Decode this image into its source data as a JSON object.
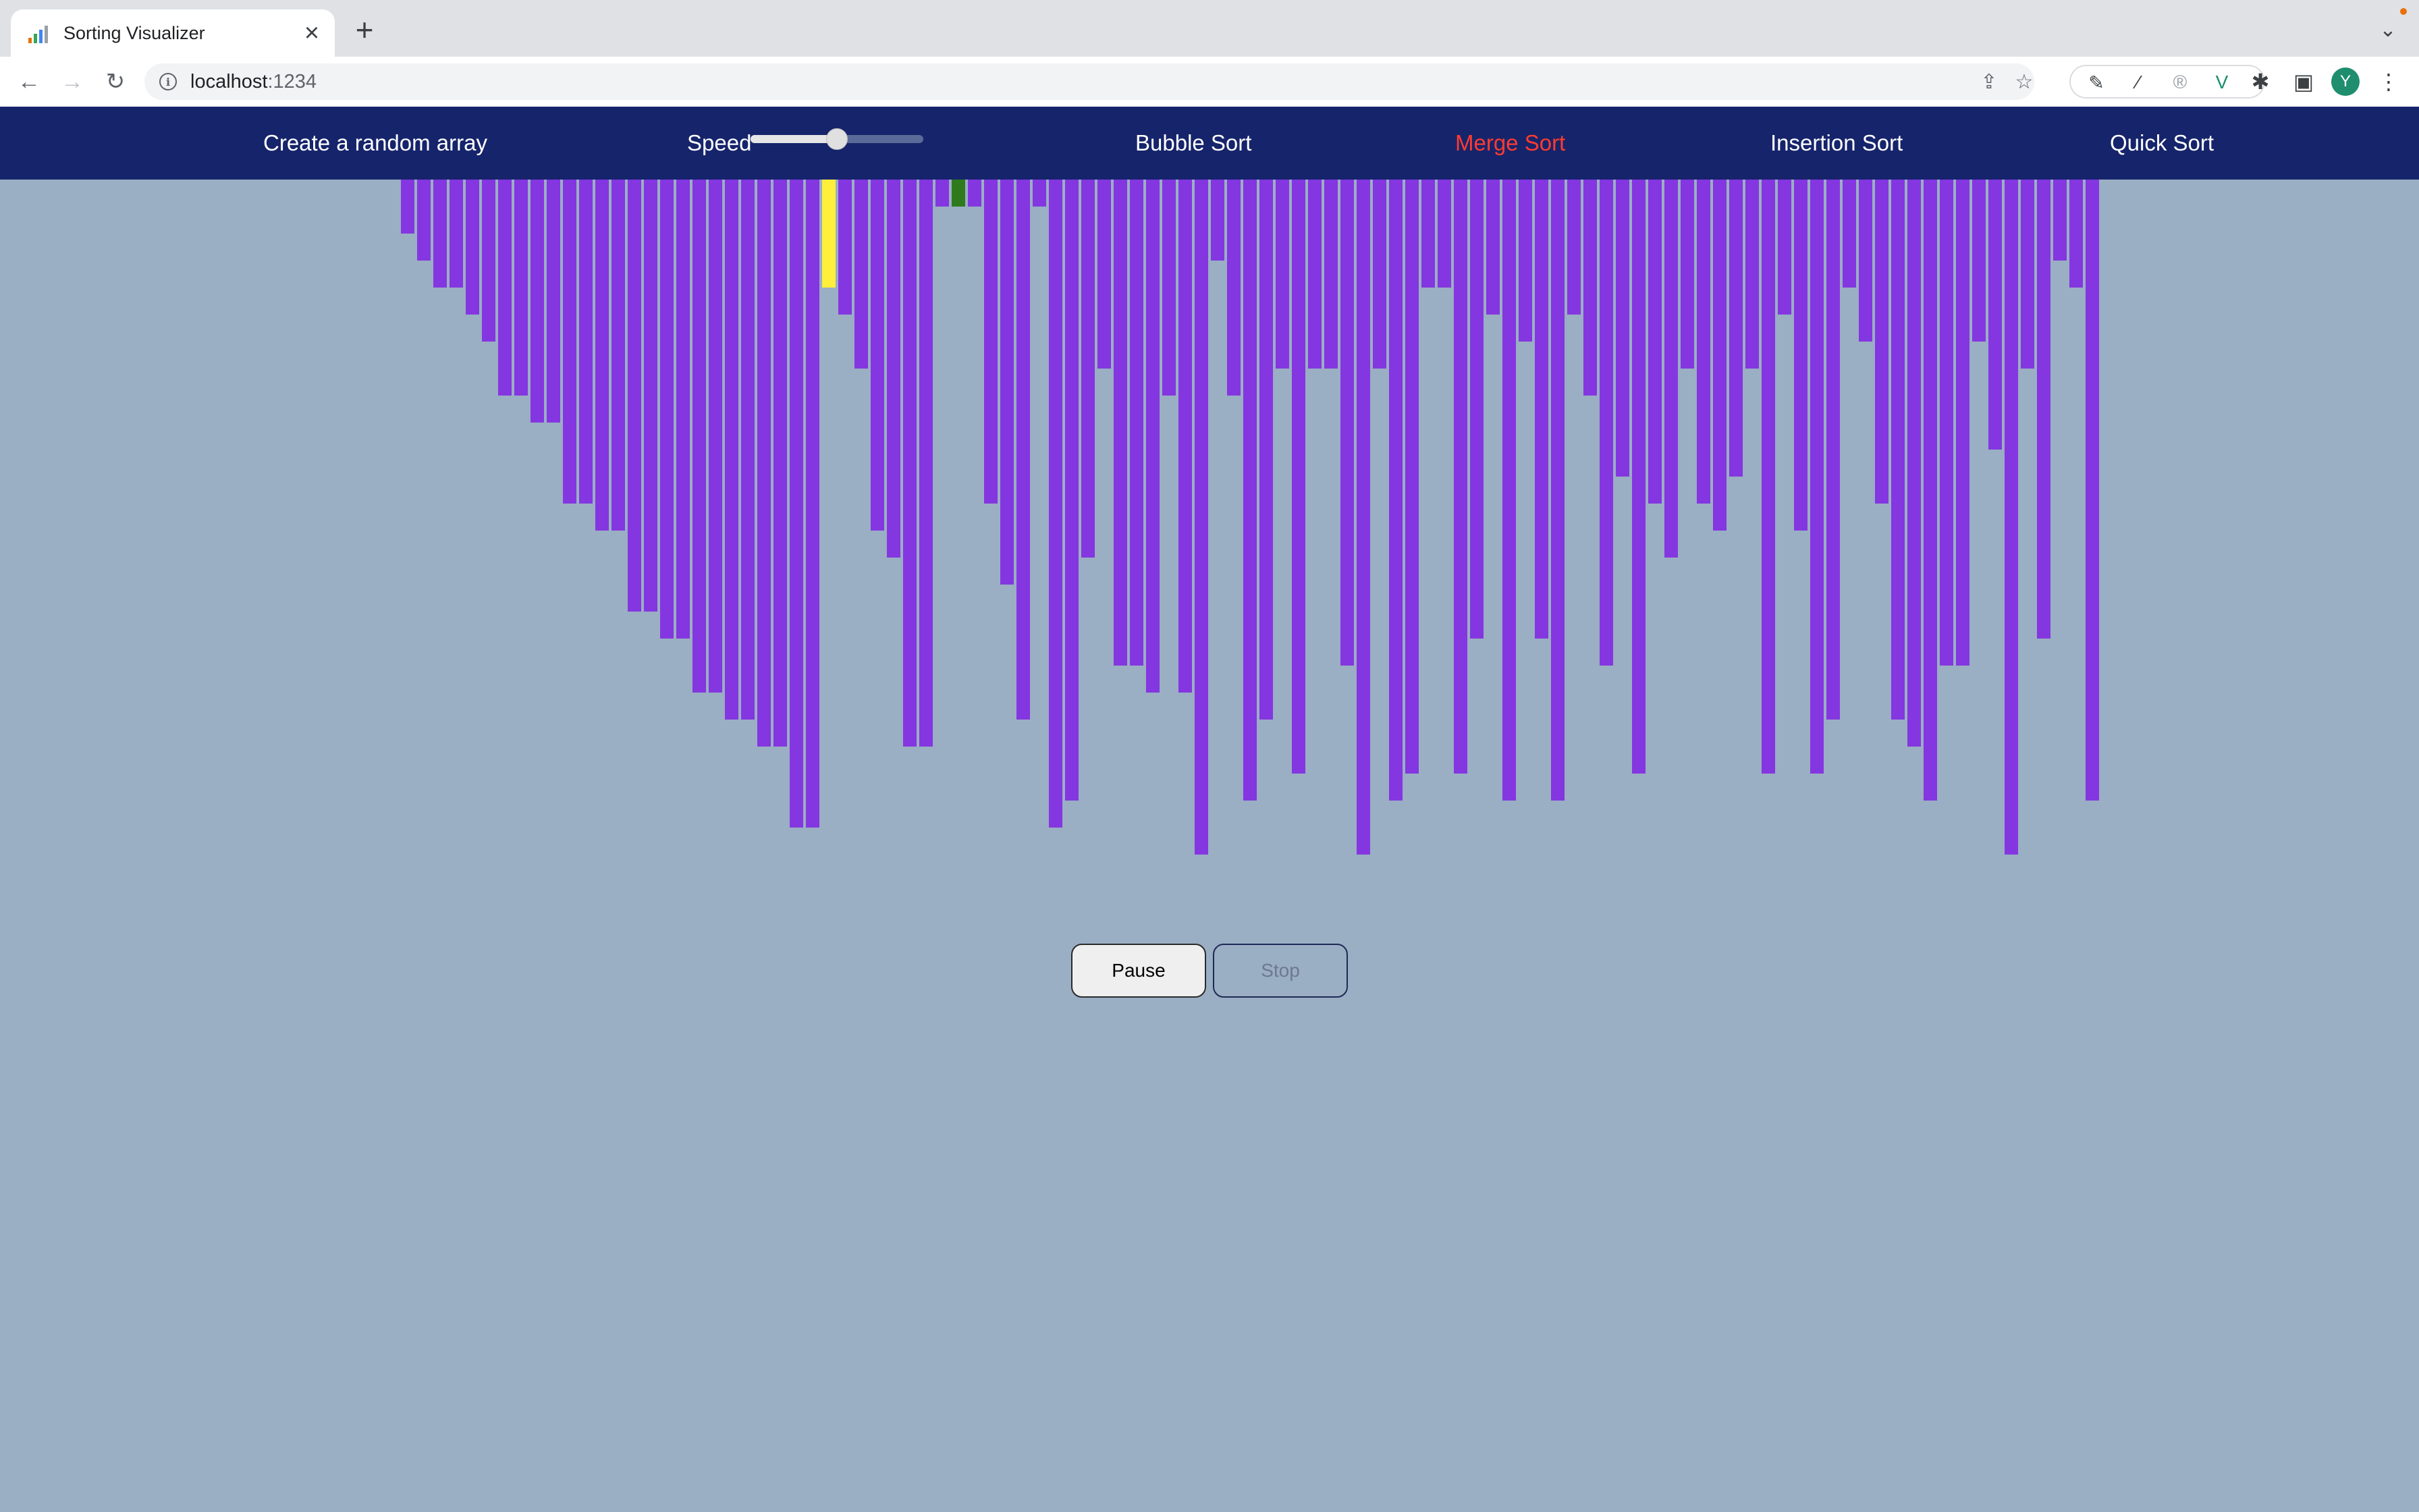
{
  "browser": {
    "tab_title": "Sorting Visualizer",
    "tab_close": "×",
    "new_tab": "+",
    "url_host": "localhost",
    "url_rest": ":1234",
    "profile_initial": "Y"
  },
  "nav": {
    "random_array": "Create a random array",
    "speed_label": "Speed",
    "bubble": "Bubble Sort",
    "merge": "Merge Sort",
    "insertion": "Insertion Sort",
    "quick": "Quick Sort",
    "active_algorithm": "Merge Sort"
  },
  "speed": {
    "value": 0.5
  },
  "colors": {
    "bar_default": "#8436e0",
    "bar_compare": "#ffef3c",
    "bar_pivot": "#2f7a1c",
    "nav_bg": "#16246b",
    "nav_active": "#ff3b30",
    "page_bg": "#9aaec4"
  },
  "array": {
    "max_value": 1000,
    "values": [
      80,
      120,
      160,
      160,
      200,
      240,
      320,
      320,
      360,
      360,
      480,
      480,
      520,
      520,
      640,
      640,
      680,
      680,
      760,
      760,
      800,
      800,
      840,
      840,
      960,
      960,
      160,
      200,
      280,
      520,
      560,
      840,
      840,
      40,
      40,
      40,
      480,
      600,
      800,
      40,
      960,
      920,
      560,
      280,
      720,
      720,
      760,
      320,
      760,
      1000,
      120,
      320,
      920,
      800,
      280,
      880,
      280,
      280,
      720,
      1000,
      280,
      920,
      880,
      160,
      160,
      880,
      680,
      200,
      920,
      240,
      680,
      920,
      200,
      320,
      720,
      440,
      880,
      480,
      560,
      280,
      480,
      520,
      440,
      280,
      880,
      200,
      520,
      880,
      800,
      160,
      240,
      480,
      800,
      840,
      920,
      720,
      720,
      240,
      400,
      1000,
      280,
      680,
      120,
      160,
      920
    ],
    "special": {
      "26": "compare",
      "34": "pivot"
    }
  },
  "controls": {
    "pause": "Pause",
    "stop": "Stop"
  }
}
